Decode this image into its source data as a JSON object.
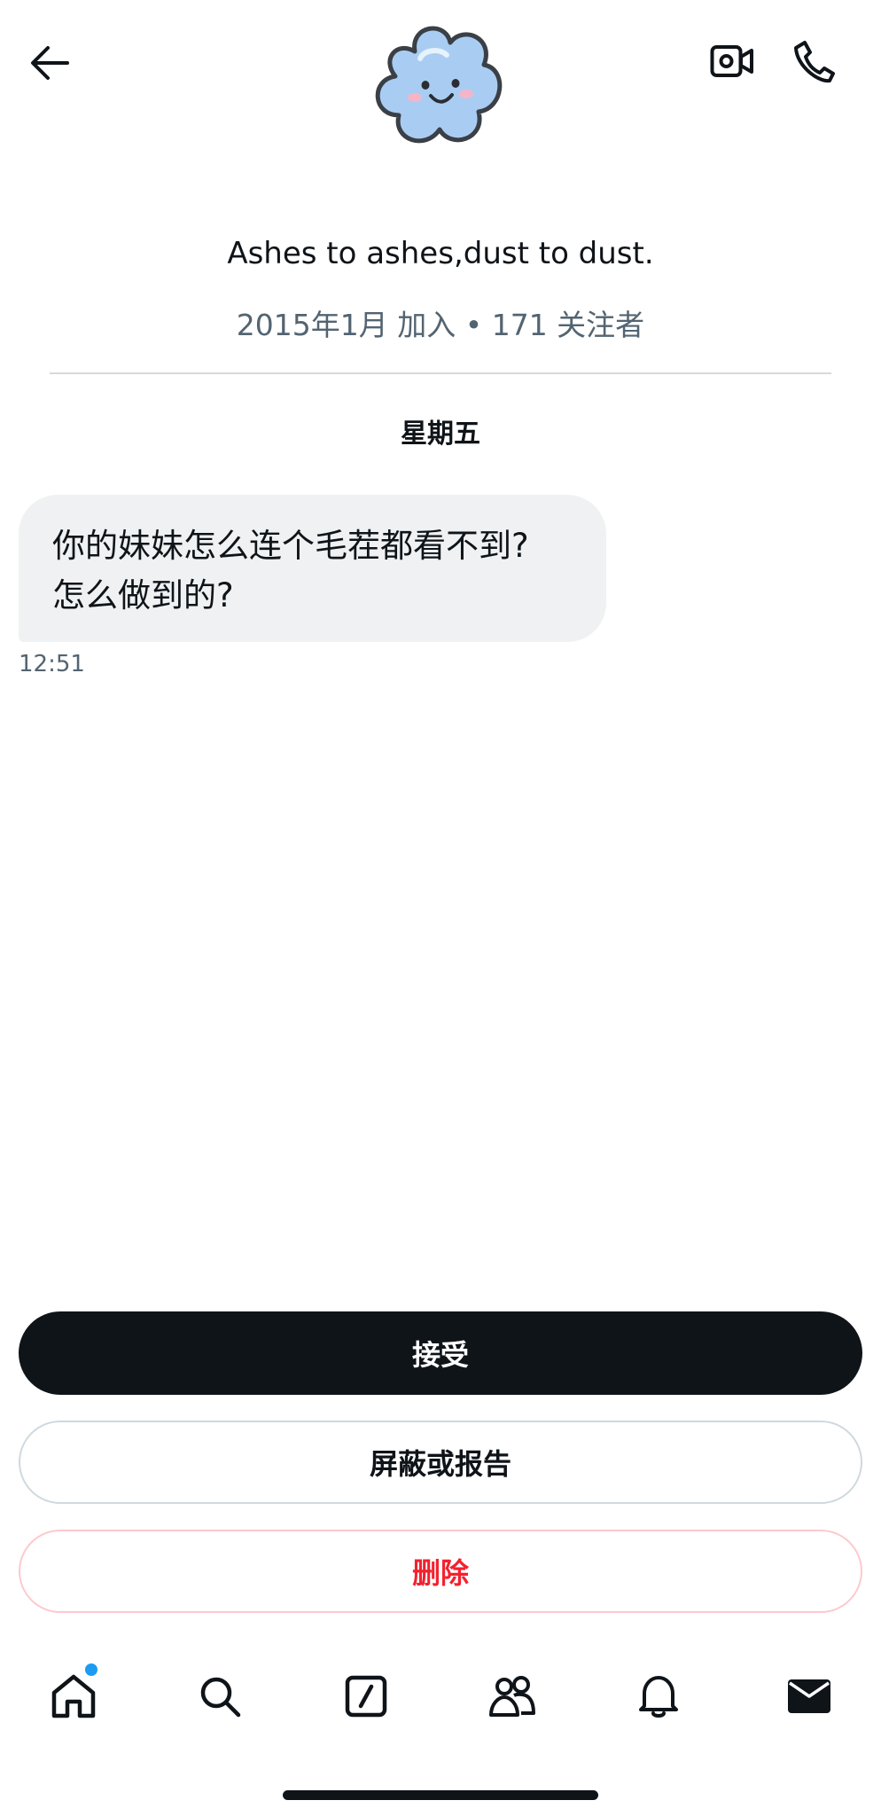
{
  "header": {
    "back_icon": "arrow-left-icon",
    "video_icon": "video-camera-icon",
    "phone_icon": "phone-icon",
    "avatar_icon": "cloud-smile-avatar"
  },
  "profile": {
    "bio": "Ashes to ashes,dust to dust.",
    "meta": "2015年1月 加入 • 171 关注者"
  },
  "conversation": {
    "day_label": "星期五",
    "message": {
      "line1": "你的妹妹怎么连个毛茬都看不到?",
      "line2": "怎么做到的?",
      "time": "12:51"
    }
  },
  "actions": {
    "accept_label": "接受",
    "block_label": "屏蔽或报告",
    "delete_label": "删除"
  },
  "nav": {
    "items": [
      "home-icon",
      "search-icon",
      "compose-icon",
      "communities-icon",
      "bell-icon",
      "mail-icon"
    ],
    "active": "mail-icon"
  },
  "colors": {
    "accent_blue": "#1d9bf0",
    "danger_red": "#f4212e",
    "text": "#0f1419",
    "muted": "#536471"
  }
}
